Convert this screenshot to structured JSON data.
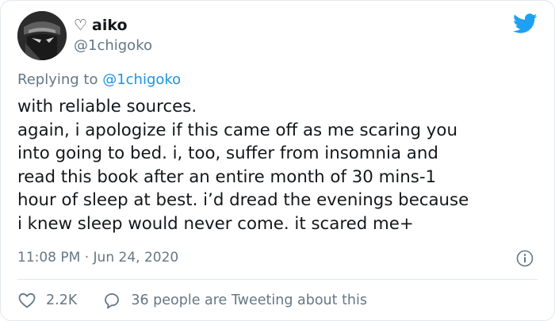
{
  "user": {
    "display_name": "aiko",
    "name_prefix_icon": "heart-outline-icon",
    "handle": "@1chigoko"
  },
  "reply": {
    "prefix": "Replying to ",
    "mention": "@1chigoko"
  },
  "tweet": {
    "text": "with reliable sources.\nagain, i apologize if this came off as me scaring you\ninto going to bed. i, too, suffer from insomnia and\nread this book after an entire month of 30 mins-1\nhour of sleep at best. i’d dread the evenings because\ni knew sleep would never come. it scared me+",
    "time": "11:08 PM",
    "separator": "·",
    "date": "Jun 24, 2020"
  },
  "actions": {
    "like_count": "2.2K",
    "reply_label": "36 people are Tweeting about this"
  },
  "colors": {
    "brand": "#1da1f2",
    "link": "#1b95e0",
    "muted": "#657786",
    "text": "#14171a",
    "border": "#e1e8ed"
  }
}
